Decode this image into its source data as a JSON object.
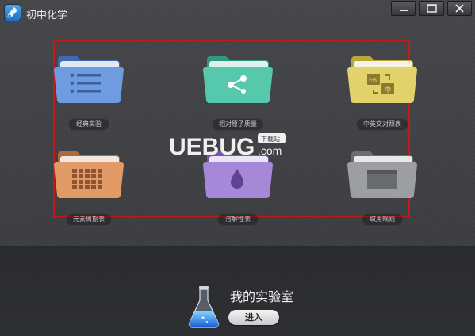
{
  "window": {
    "title": "初中化学",
    "icon": "flask-app-icon"
  },
  "tiles": [
    {
      "label": "经典实验",
      "color": "#6f9be0",
      "icon": "list-icon"
    },
    {
      "label": "相对原子质量",
      "color": "#56c9ad",
      "icon": "molecule-icon"
    },
    {
      "label": "中英文对照表",
      "color": "#e2d26c",
      "icon": "translate-icon"
    },
    {
      "label": "元素周期表",
      "color": "#e29a66",
      "icon": "periodic-table-icon"
    },
    {
      "label": "溶解性表",
      "color": "#a589d8",
      "icon": "drop-icon"
    },
    {
      "label": "取用规则",
      "color": "#9d9ea2",
      "icon": "window-icon"
    }
  ],
  "lab": {
    "title": "我的实验室",
    "enter_label": "进入"
  },
  "watermark": {
    "brand": "UEBUG",
    "suffix": ".com",
    "badge": "下载站"
  },
  "colors": {
    "highlight_border": "#c4191b",
    "background": "#3a3b3e"
  }
}
